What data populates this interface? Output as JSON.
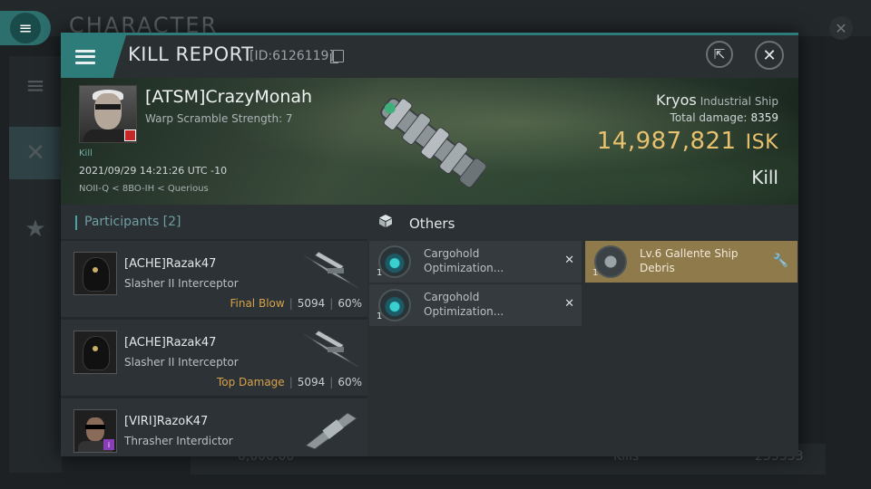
{
  "background": {
    "title": "CHARACTER",
    "bottom_values": [
      "0,000.00",
      "Kills",
      "235333"
    ]
  },
  "header": {
    "title": "KILL REPORT",
    "report_id": "[ID:6126119]"
  },
  "victim": {
    "name": "[ATSM]CrazyMonah",
    "scram": "Warp Scramble Strength: 7",
    "kill_tag": "Kill",
    "datetime": "2021/09/29 14:21:26 UTC -10",
    "location": "NOII-Q < 8BO-IH < Querious",
    "ship_name": "Kryos",
    "ship_class": "Industrial Ship",
    "total_damage_label": "Total damage:",
    "total_damage": "8359",
    "isk_value": "14,987,821",
    "isk_unit": "ISK",
    "result": "Kill"
  },
  "participants": {
    "label": "Participants [2]",
    "rows": [
      {
        "name": "[ACHE]Razak47",
        "ship": "Slasher II Interceptor",
        "tag": "Final Blow",
        "damage": "5094",
        "percent": "60%"
      },
      {
        "name": "[ACHE]Razak47",
        "ship": "Slasher II Interceptor",
        "tag": "Top Damage",
        "damage": "5094",
        "percent": "60%"
      },
      {
        "name": "[VIRI]RazoK47",
        "ship": "Thrasher Interdictor",
        "tag": "",
        "damage": "",
        "percent": ""
      }
    ]
  },
  "others": {
    "label": "Others",
    "items": [
      {
        "qty": "1",
        "name": "Cargohold Optimization...",
        "status": "destroyed"
      },
      {
        "qty": "1",
        "name": "Lv.6 Gallente Ship Debris",
        "status": "dropped"
      },
      {
        "qty": "1",
        "name": "Cargohold Optimization...",
        "status": "destroyed"
      }
    ]
  },
  "colors": {
    "accent": "#2d7c79",
    "isk": "#e8c16e",
    "tag": "#d6a24a",
    "dropped_item": "#8f7a4c"
  }
}
